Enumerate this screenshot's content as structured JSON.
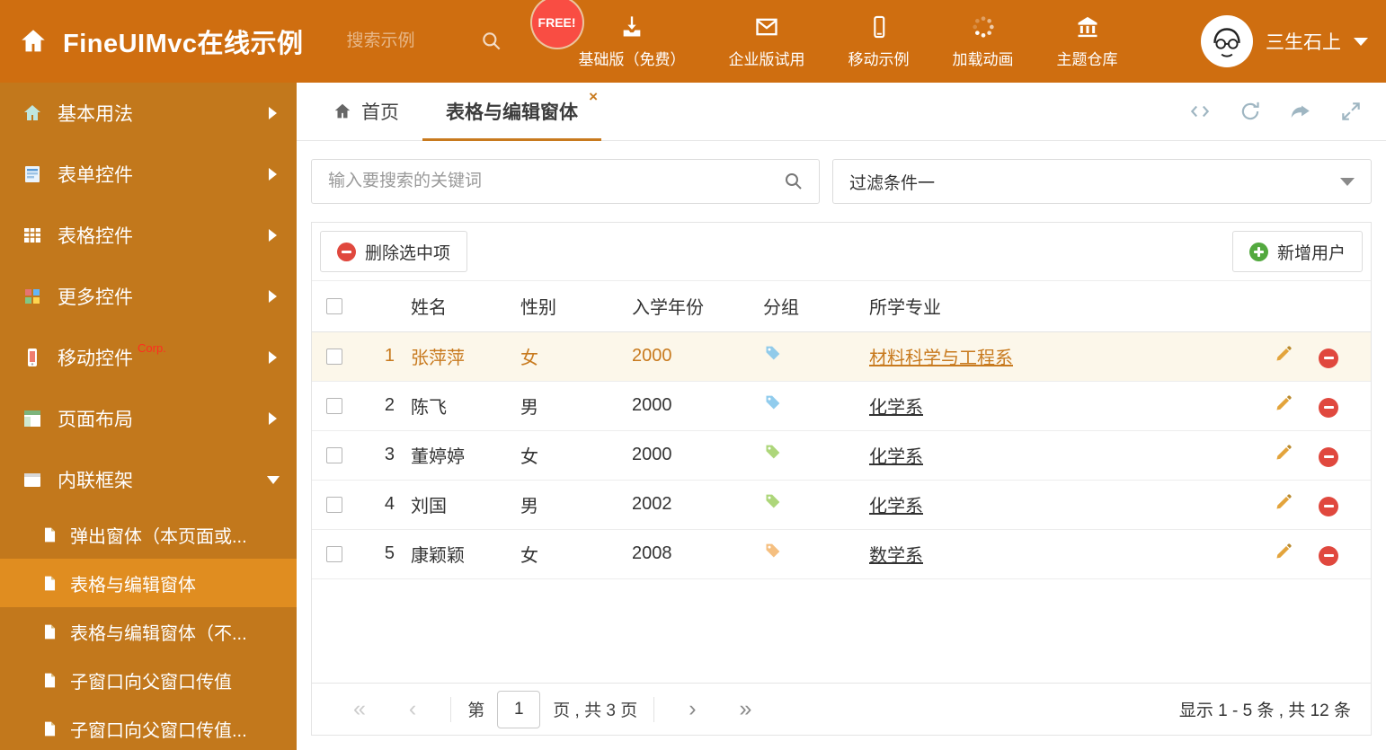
{
  "colors": {
    "accent_orange": "#c87a1e",
    "header_bg": "#cf6e10",
    "sidebar_bg": "#c2781c",
    "sidebar_active_bg": "#e08d20",
    "free_badge_red": "#f94d43",
    "delete_red": "#e0483e",
    "add_green": "#53a93f",
    "highlight_row_bg": "#fcf7ea"
  },
  "header": {
    "title": "FineUIMvc在线示例",
    "search_placeholder": "搜索示例",
    "free_badge": "FREE!",
    "nav_items": [
      {
        "label": "基础版（免费）",
        "icon": "download-icon"
      },
      {
        "label": "企业版试用",
        "icon": "envelope-icon"
      },
      {
        "label": "移动示例",
        "icon": "mobile-icon"
      },
      {
        "label": "加载动画",
        "icon": "spinner-icon"
      },
      {
        "label": "主题仓库",
        "icon": "bank-icon"
      }
    ],
    "user_name": "三生石上"
  },
  "sidebar": {
    "items": [
      {
        "label": "基本用法"
      },
      {
        "label": "表单控件"
      },
      {
        "label": "表格控件"
      },
      {
        "label": "更多控件"
      },
      {
        "label": "移动控件",
        "badge": "Corp."
      },
      {
        "label": "页面布局"
      },
      {
        "label": "内联框架",
        "expanded": true
      }
    ],
    "subitems": [
      {
        "label": "弹出窗体（本页面或..."
      },
      {
        "label": "表格与编辑窗体",
        "active": true
      },
      {
        "label": "表格与编辑窗体（不..."
      },
      {
        "label": "子窗口向父窗口传值"
      },
      {
        "label": "子窗口向父窗口传值..."
      }
    ]
  },
  "tabs": [
    {
      "label": "首页"
    },
    {
      "label": "表格与编辑窗体",
      "active": true
    }
  ],
  "filter": {
    "search_placeholder": "输入要搜索的关键词",
    "dropdown_value": "过滤条件一"
  },
  "toolbar": {
    "delete_label": "删除选中项",
    "add_label": "新增用户"
  },
  "table": {
    "columns": [
      "姓名",
      "性别",
      "入学年份",
      "分组",
      "所学专业"
    ],
    "rows": [
      {
        "index": "1",
        "name": "张萍萍",
        "gender": "女",
        "year": "2000",
        "tag_color": "#7ec3ea",
        "major": "材料科学与工程系",
        "highlighted": true
      },
      {
        "index": "2",
        "name": "陈飞",
        "gender": "男",
        "year": "2000",
        "tag_color": "#7ec3ea",
        "major": "化学系"
      },
      {
        "index": "3",
        "name": "董婷婷",
        "gender": "女",
        "year": "2000",
        "tag_color": "#9fcf63",
        "major": "化学系"
      },
      {
        "index": "4",
        "name": "刘国",
        "gender": "男",
        "year": "2002",
        "tag_color": "#9fcf63",
        "major": "化学系"
      },
      {
        "index": "5",
        "name": "康颖颖",
        "gender": "女",
        "year": "2008",
        "tag_color": "#f3b46a",
        "major": "数学系"
      }
    ]
  },
  "pagination": {
    "page_prefix": "第",
    "current_page": "1",
    "pages_suffix": "页 , 共 3 页",
    "summary": "显示 1 - 5 条 , 共 12 条"
  }
}
